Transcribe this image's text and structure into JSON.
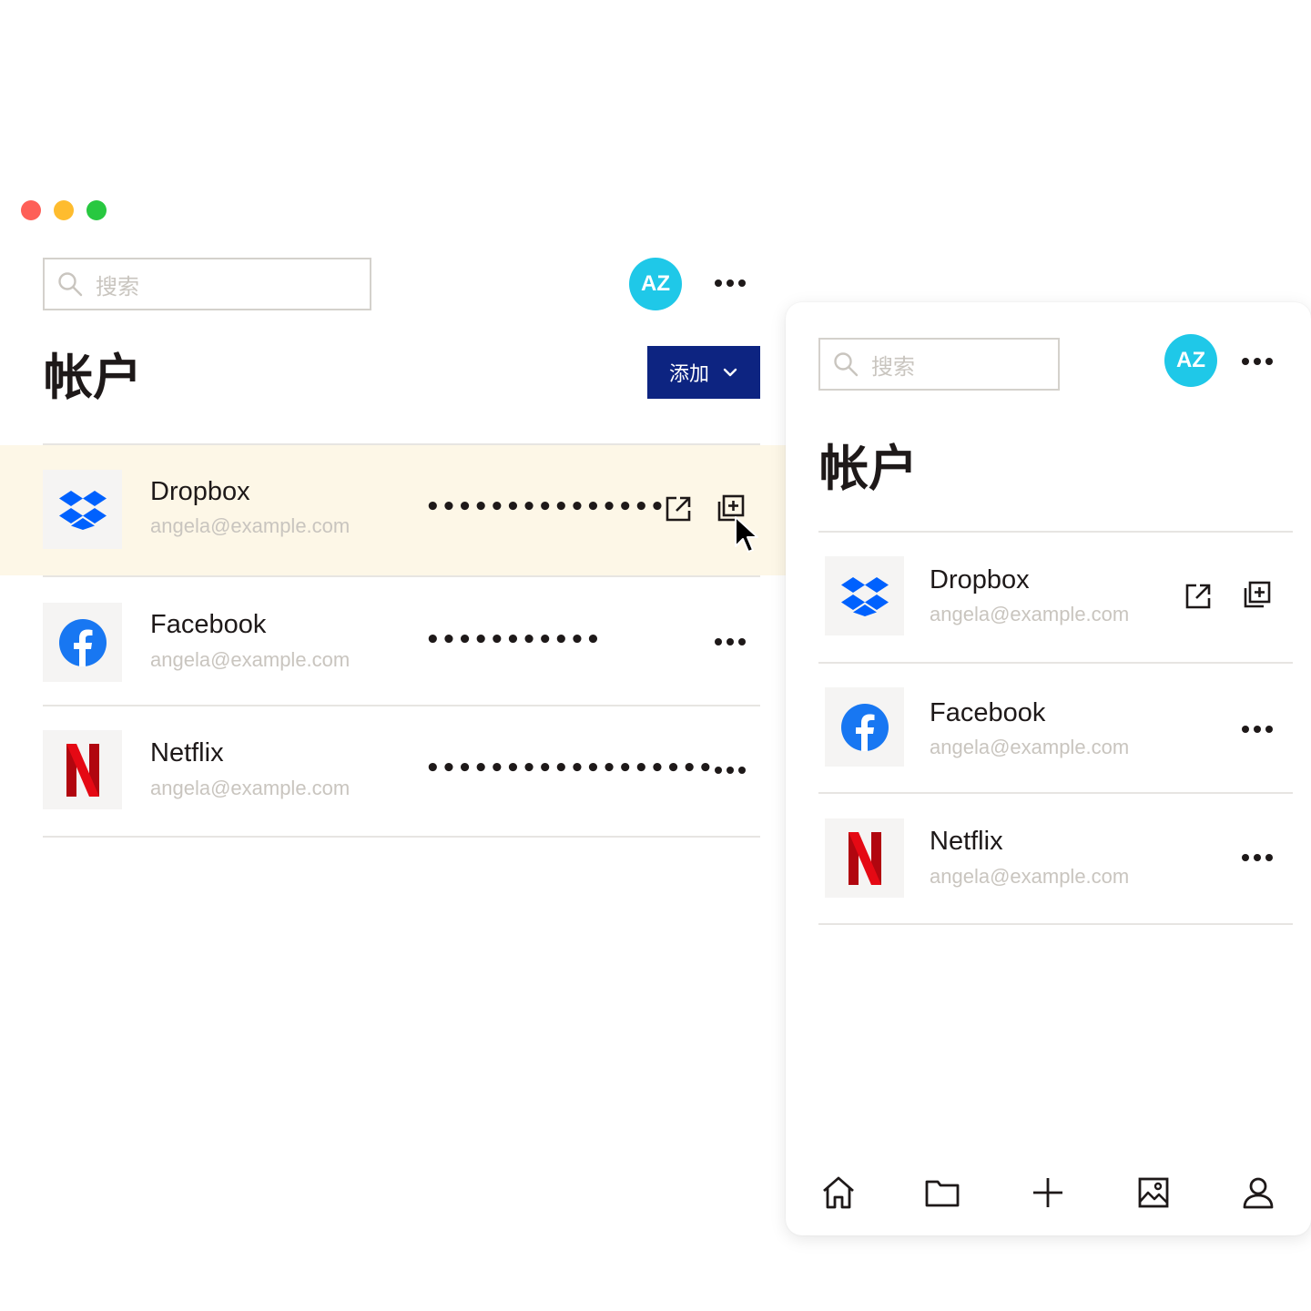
{
  "window": {
    "traffic_lights": [
      "close",
      "minimize",
      "maximize"
    ]
  },
  "colors": {
    "accent": "#0d2481",
    "avatar": "#1fc8e8",
    "highlight_row": "#fdf7e7",
    "dropbox": "#0061fe",
    "facebook": "#1877f2",
    "netflix": "#e50914"
  },
  "desktop": {
    "search": {
      "placeholder": "搜索"
    },
    "avatar_initials": "AZ",
    "title": "帐户",
    "add_button": {
      "label": "添加"
    },
    "accounts": [
      {
        "name": "Dropbox",
        "email": "angela@example.com",
        "password": "•••••••••••••••",
        "logo": "dropbox-logo",
        "actions": [
          "external-link-icon",
          "copy-icon"
        ]
      },
      {
        "name": "Facebook",
        "email": "angela@example.com",
        "password": "•••••••••••",
        "logo": "facebook-logo",
        "actions": [
          "more-icon"
        ]
      },
      {
        "name": "Netflix",
        "email": "angela@example.com",
        "password": "••••••••••••••••••",
        "logo": "netflix-logo",
        "actions": [
          "more-icon"
        ]
      }
    ]
  },
  "mobile": {
    "search": {
      "placeholder": "搜索"
    },
    "avatar_initials": "AZ",
    "title": "帐户",
    "accounts": [
      {
        "name": "Dropbox",
        "email": "angela@example.com",
        "logo": "dropbox-logo",
        "actions": [
          "external-link-icon",
          "copy-icon"
        ]
      },
      {
        "name": "Facebook",
        "email": "angela@example.com",
        "logo": "facebook-logo",
        "actions": [
          "more-icon"
        ]
      },
      {
        "name": "Netflix",
        "email": "angela@example.com",
        "logo": "netflix-logo",
        "actions": [
          "more-icon"
        ]
      }
    ],
    "nav": [
      "home-icon",
      "folder-icon",
      "plus-icon",
      "photo-icon",
      "user-icon"
    ]
  }
}
